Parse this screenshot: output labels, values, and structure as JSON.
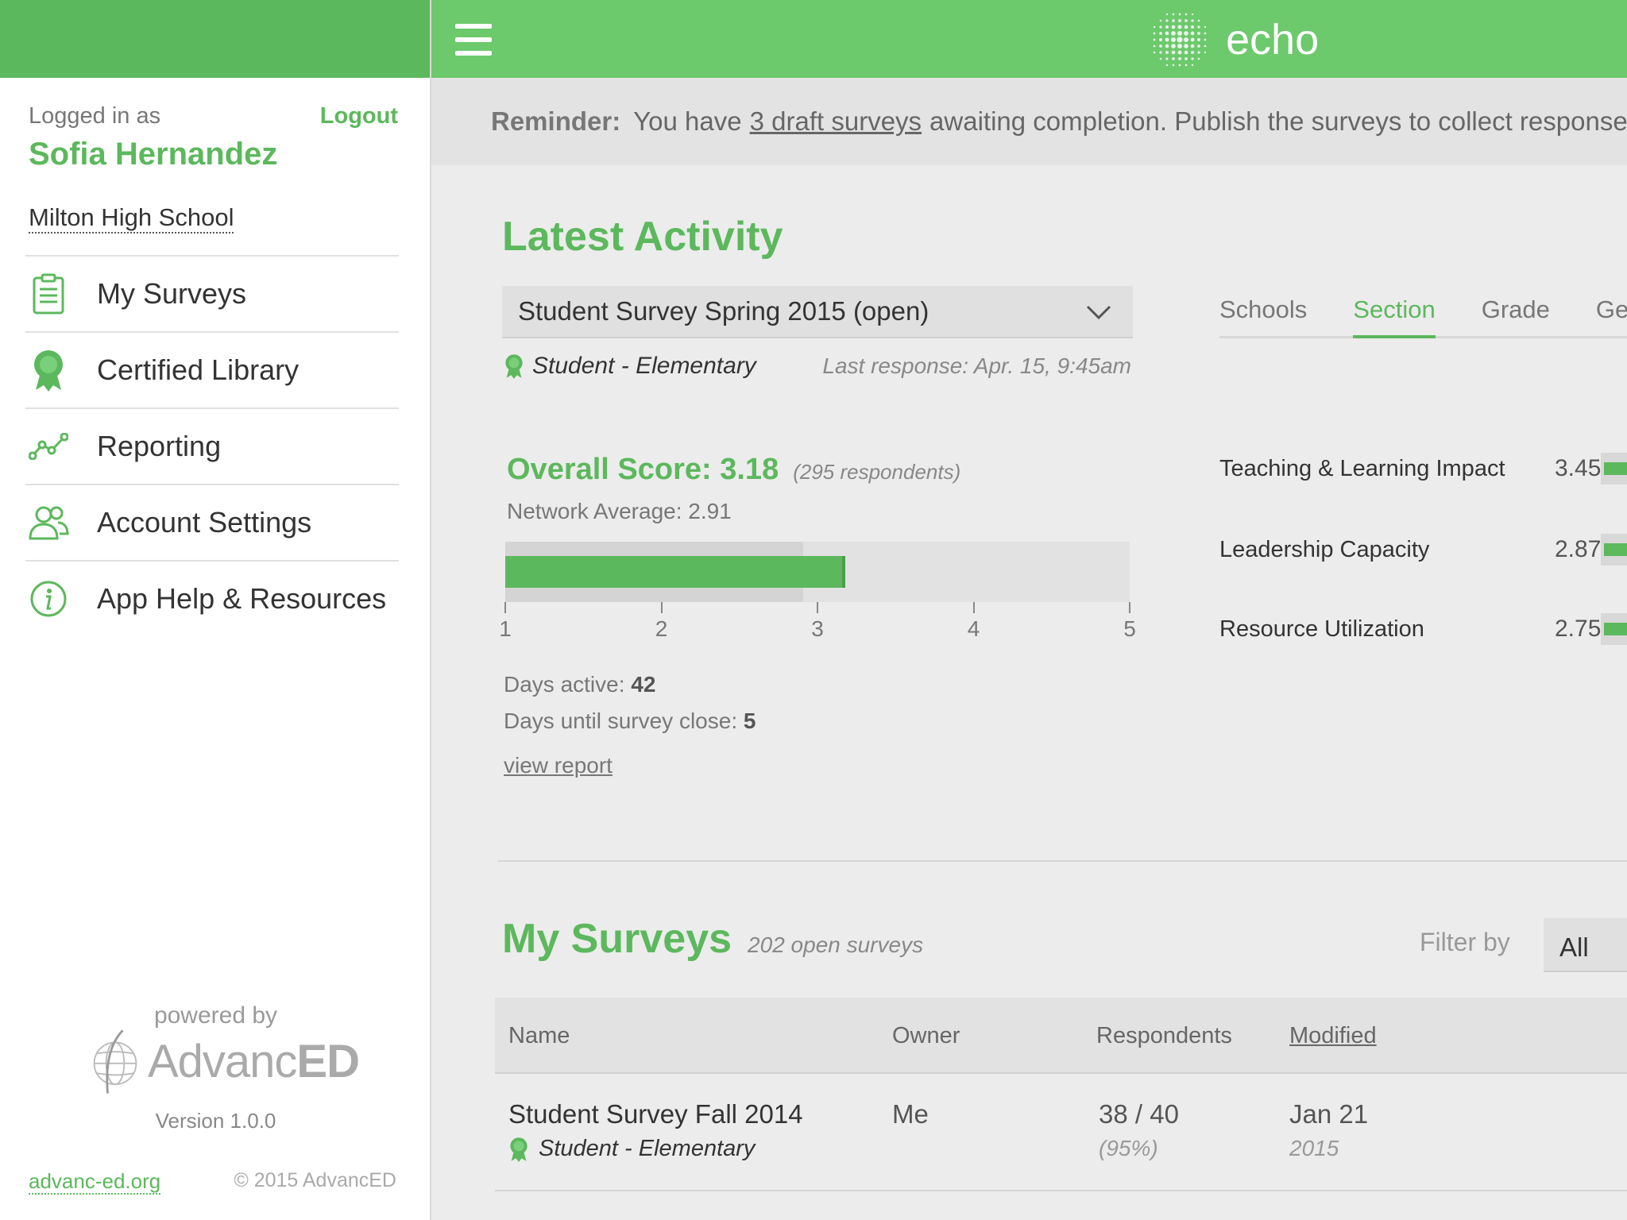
{
  "sidebar": {
    "logged_in_label": "Logged in as",
    "logout_label": "Logout",
    "user_name": "Sofia Hernandez",
    "school": "Milton High School",
    "items": [
      {
        "label": "My Surveys",
        "icon": "clipboard-icon"
      },
      {
        "label": "Certified Library",
        "icon": "award-ribbon-icon"
      },
      {
        "label": "Reporting",
        "icon": "line-chart-icon"
      },
      {
        "label": "Account Settings",
        "icon": "users-icon"
      },
      {
        "label": "App Help & Resources",
        "icon": "info-icon"
      }
    ],
    "powered_by": "powered by",
    "logo_text_light": "Advanc",
    "logo_text_bold": "ED",
    "version": "Version 1.0.0",
    "site_link": "advanc-ed.org",
    "copyright": "© 2015 AdvancED"
  },
  "header": {
    "brand": "echo"
  },
  "reminder": {
    "label": "Reminder:",
    "before": "You have",
    "link": "3 draft surveys",
    "after": "awaiting completion. Publish the surveys to collect responses."
  },
  "latest": {
    "title": "Latest Activity",
    "selected_survey": "Student Survey Spring 2015 (open)",
    "category": "Student - Elementary",
    "last_response": "Last response:  Apr. 15, 9:45am",
    "tabs": [
      "Schools",
      "Section",
      "Grade",
      "Gender"
    ],
    "active_tab": "Section",
    "overall_label": "Overall Score: 3.18",
    "respondents": "(295 respondents)",
    "network_average": "Network Average: 2.91",
    "score": 3.18,
    "network_score": 2.91,
    "scale_ticks": [
      "1",
      "2",
      "3",
      "4",
      "5"
    ],
    "days_active_label": "Days active:",
    "days_active": "42",
    "days_close_label": "Days until survey close:",
    "days_close": "5",
    "view_report": "view report",
    "metrics": [
      {
        "name": "Teaching & Learning Impact",
        "value": "3.45"
      },
      {
        "name": "Leadership Capacity",
        "value": "2.87"
      },
      {
        "name": "Resource Utilization",
        "value": "2.75"
      }
    ]
  },
  "surveys": {
    "title": "My Surveys",
    "count": "202 open surveys",
    "filter_label": "Filter by",
    "filter_value": "All",
    "columns": [
      "Name",
      "Owner",
      "Respondents",
      "Modified"
    ],
    "rows": [
      {
        "name": "Student Survey Fall 2014",
        "category": "Student - Elementary",
        "owner": "Me",
        "respondents": "38 / 40",
        "percent": "(95%)",
        "modified": "Jan 21",
        "modified_year": "2015"
      }
    ]
  },
  "colors": {
    "accent": "#5cb85c",
    "header": "#6cc96c"
  }
}
